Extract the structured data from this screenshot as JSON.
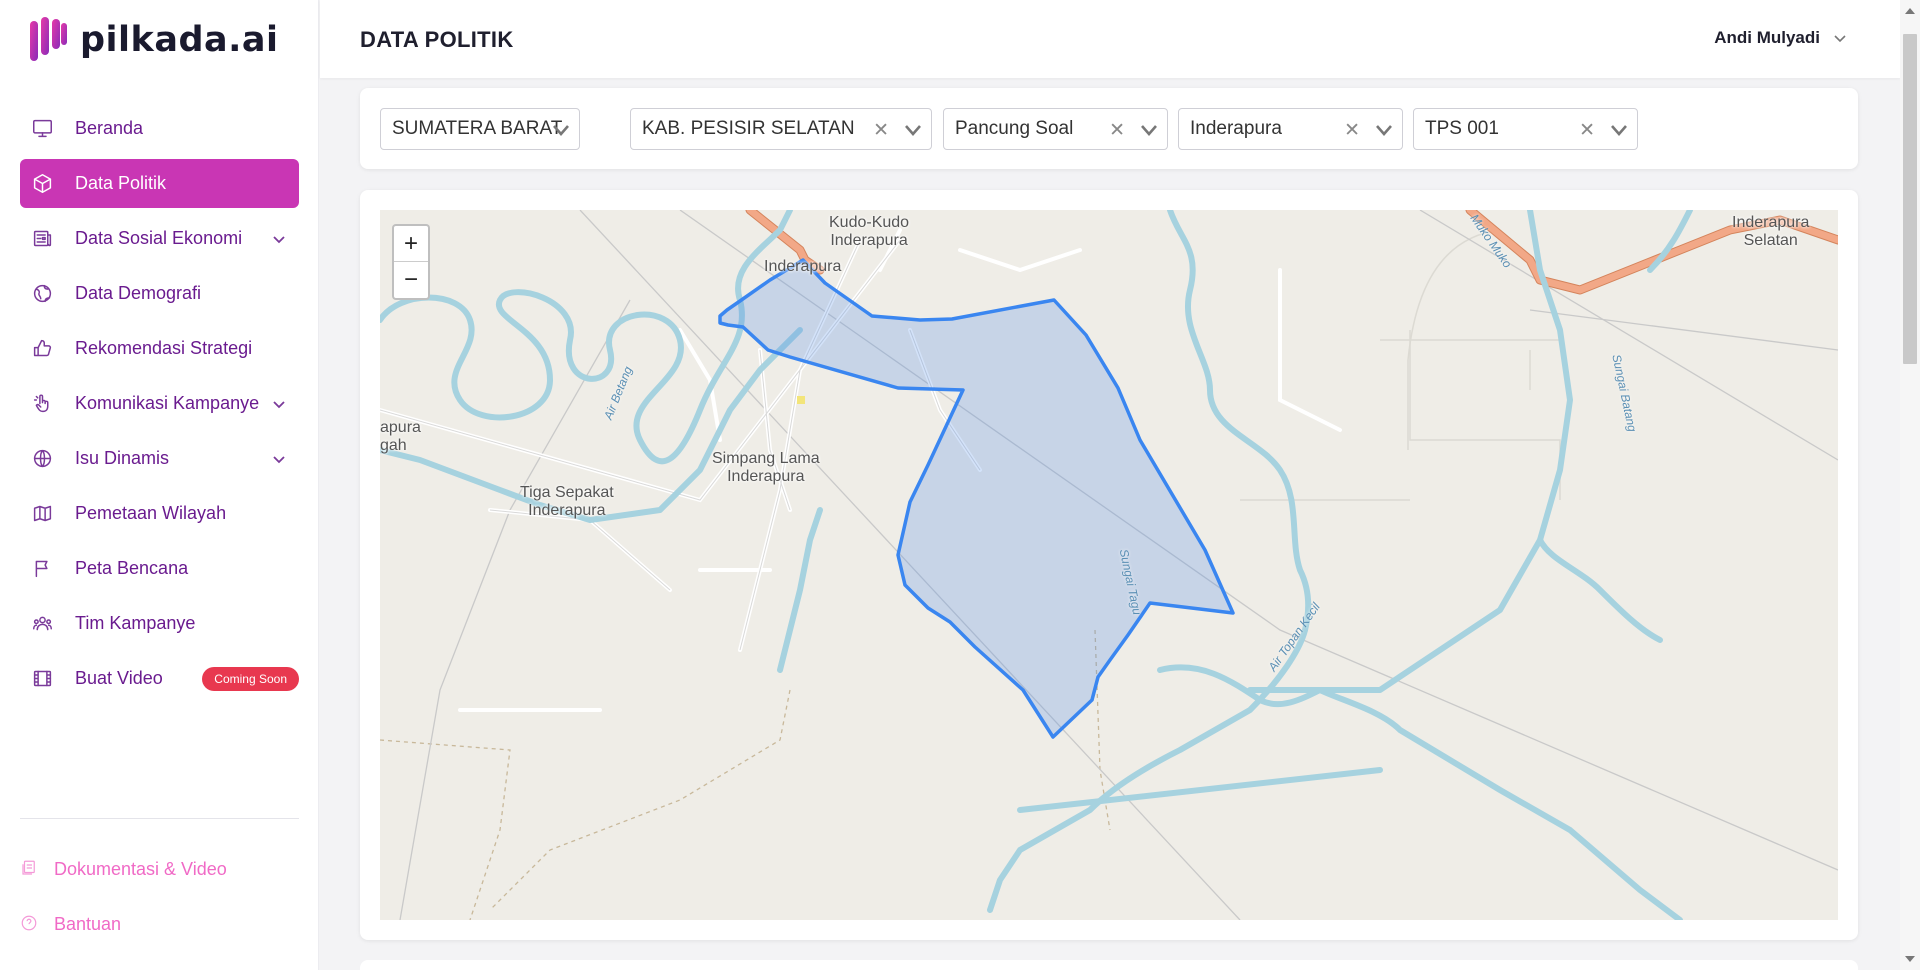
{
  "app": {
    "name": "pilkada.ai"
  },
  "sidebar": {
    "items": [
      {
        "label": "Beranda",
        "icon": "monitor-icon"
      },
      {
        "label": "Data Politik",
        "icon": "box-icon",
        "active": true
      },
      {
        "label": "Data Sosial Ekonomi",
        "icon": "newspaper-icon",
        "expandable": true
      },
      {
        "label": "Data Demografi",
        "icon": "globe-icon"
      },
      {
        "label": "Rekomendasi Strategi",
        "icon": "thumbs-up-icon"
      },
      {
        "label": "Komunikasi Kampanye",
        "icon": "hand-pointer-icon",
        "expandable": true
      },
      {
        "label": "Isu Dinamis",
        "icon": "world-icon",
        "expandable": true
      },
      {
        "label": "Pemetaan Wilayah",
        "icon": "map-icon"
      },
      {
        "label": "Peta Bencana",
        "icon": "flag-icon"
      },
      {
        "label": "Tim Kampanye",
        "icon": "users-icon"
      },
      {
        "label": "Buat Video",
        "icon": "film-icon",
        "badge": "Coming Soon"
      }
    ],
    "footer": [
      {
        "label": "Dokumentasi & Video",
        "icon": "docs-icon"
      },
      {
        "label": "Bantuan",
        "icon": "help-icon"
      }
    ],
    "colors": {
      "active_bg": "#c936b4",
      "text": "#6a1b8f",
      "badge": "#e8384f"
    }
  },
  "header": {
    "title": "DATA POLITIK",
    "user_name": "Andi Mulyadi"
  },
  "filters": [
    {
      "value": "SUMATERA BARAT",
      "clearable": false
    },
    {
      "value": "KAB. PESISIR SELATAN",
      "clearable": true
    },
    {
      "value": "Pancung Soal",
      "clearable": true
    },
    {
      "value": "Inderapura",
      "clearable": true
    },
    {
      "value": "TPS 001",
      "clearable": true
    }
  ],
  "filter_clear_symbol": "✕",
  "map": {
    "zoom_in": "+",
    "zoom_out": "−",
    "place_labels": {
      "kudo": "Kudo-Kudo\nInderapura",
      "inderapura": "Inderapura",
      "inderapura_selatan": "Inderapura\nSelatan",
      "simpang_lama": "Simpang Lama\nInderapura",
      "tiga_sepakat": "Tiga Sepakat\nInderapura",
      "left_edge": "apura\ngah"
    },
    "river_labels": {
      "air_betang": "Air Betang",
      "sungai_batang": "Sungai Batang",
      "sungai_tagu": "Sungai Tagu",
      "air_topan": "Air Topan Kecil",
      "muko": "Muko Muko"
    },
    "polygon_color": "#3a86f0"
  }
}
